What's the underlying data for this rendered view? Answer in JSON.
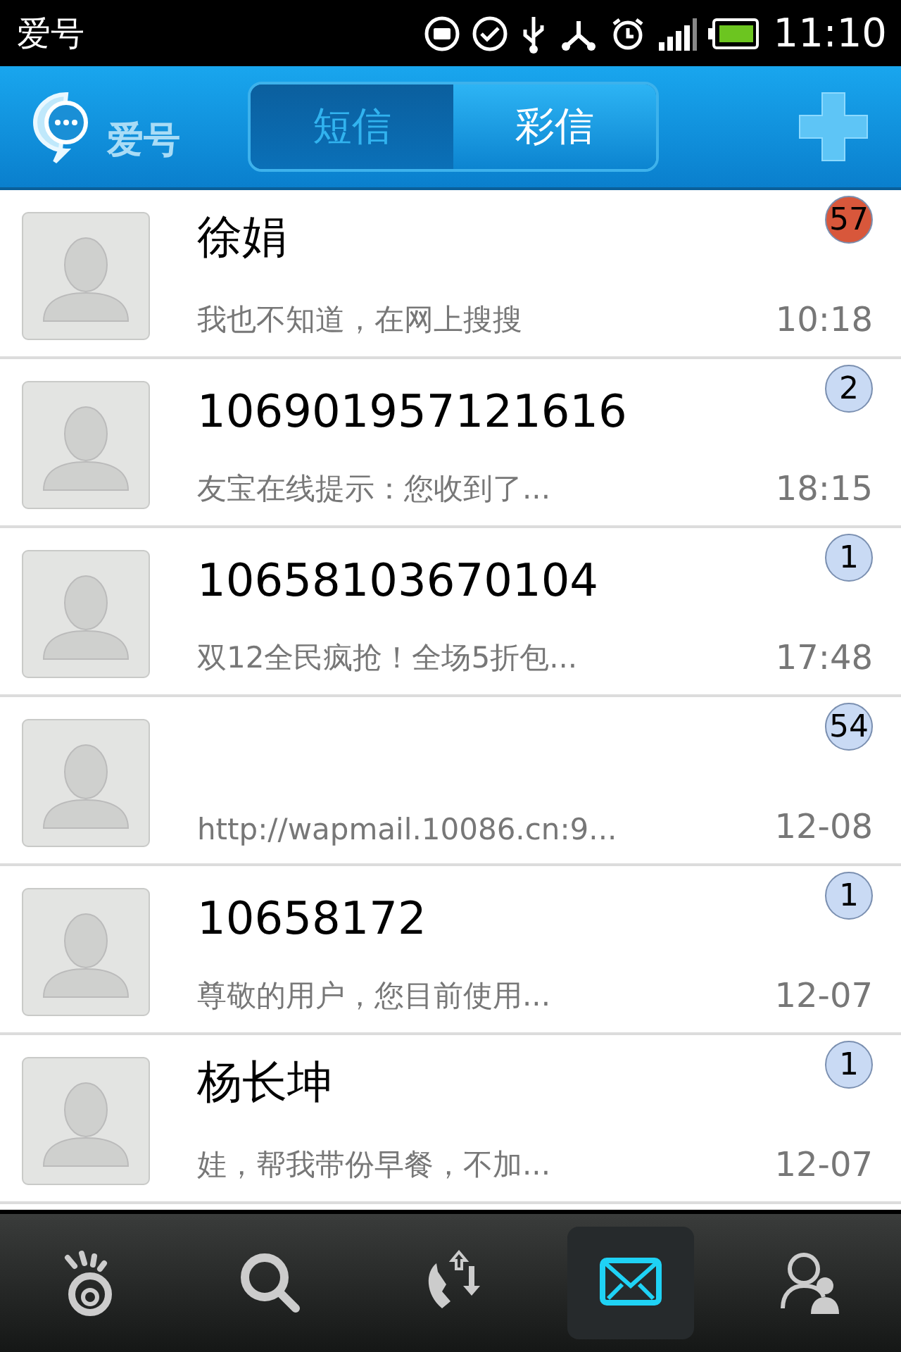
{
  "status_bar": {
    "title": "爱号",
    "time": "11:10"
  },
  "header": {
    "app_name": "爱号",
    "tabs": [
      {
        "label": "短信",
        "selected": true
      },
      {
        "label": "彩信",
        "selected": false
      }
    ]
  },
  "conversations": [
    {
      "name": "徐娟",
      "preview": "我也不知道，在网上搜搜",
      "time": "10:18",
      "count": "57",
      "color": "#d8573b"
    },
    {
      "name": "106901957121616",
      "preview": "友宝在线提示：您收到了...",
      "time": "18:15",
      "count": "2",
      "color": "#c9daf4"
    },
    {
      "name": "10658103670104",
      "preview": "双12全民疯抢！全场5折包...",
      "time": "17:48",
      "count": "1",
      "color": "#c9daf4"
    },
    {
      "preview": "http://wapmail.10086.cn:9...",
      "time": "12-08",
      "count": "54",
      "color": "#c9daf4"
    },
    {
      "name": "10658172",
      "preview": "尊敬的用户，您目前使用...",
      "time": "12-07",
      "count": "1",
      "color": "#c9daf4"
    },
    {
      "name": "杨长坤",
      "preview": "娃，帮我带份早餐，不加...",
      "time": "12-07",
      "count": "1",
      "color": "#c9daf4"
    }
  ],
  "nav": [
    {
      "kind": "eye",
      "selected": false
    },
    {
      "kind": "search",
      "selected": false
    },
    {
      "kind": "calls",
      "selected": false
    },
    {
      "kind": "mail",
      "selected": true
    },
    {
      "kind": "contacts",
      "selected": false
    }
  ]
}
